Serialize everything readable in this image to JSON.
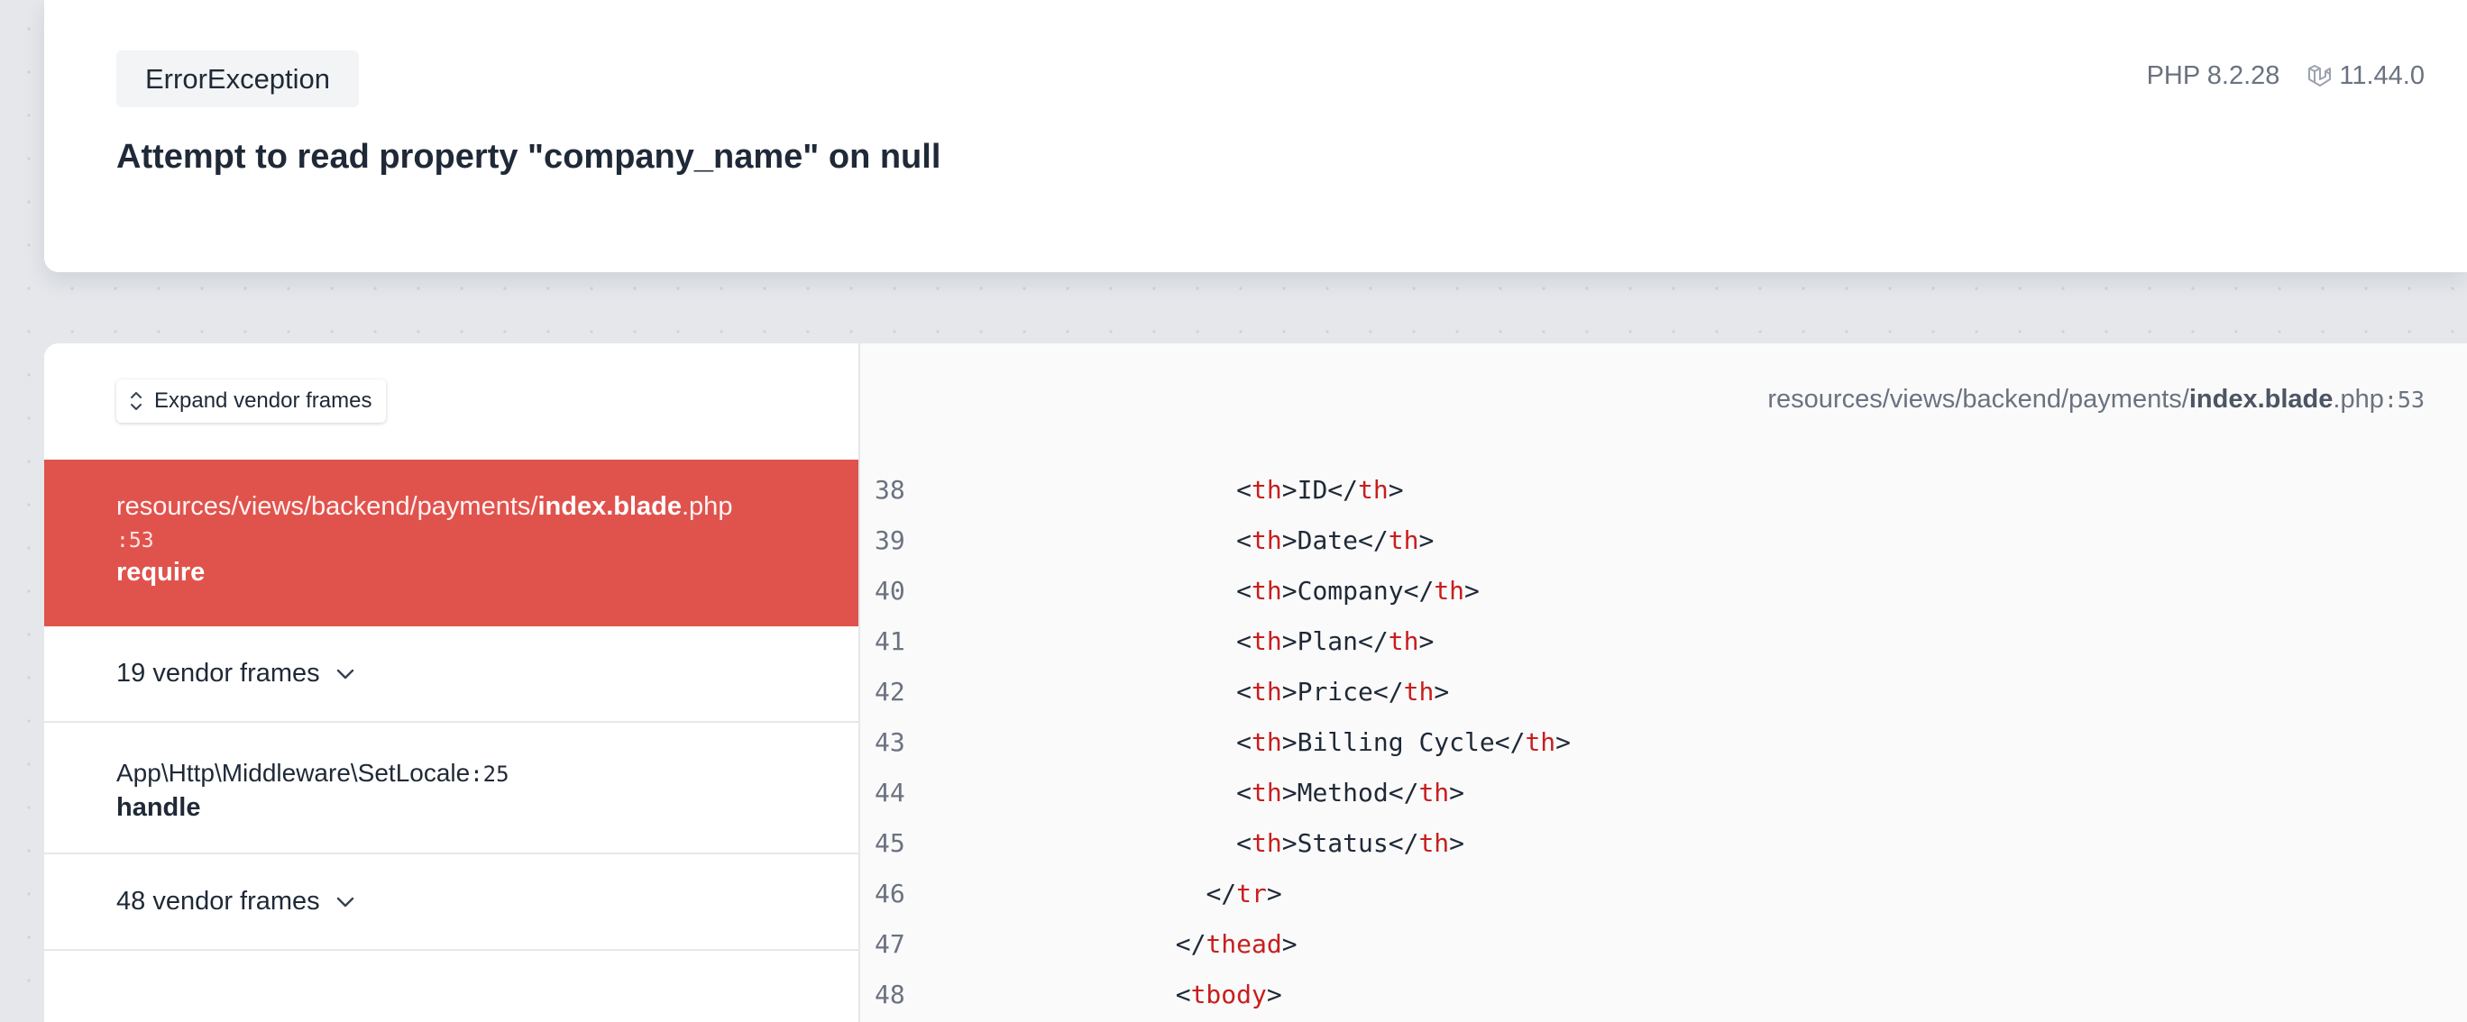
{
  "header": {
    "exception_type": "ErrorException",
    "message": "Attempt to read property \"company_name\" on null",
    "php_version": "PHP 8.2.28",
    "laravel_version": "11.44.0"
  },
  "frames_panel": {
    "expand_label": "Expand vendor frames",
    "active_frame": {
      "path": "resources/views/backend/payments/",
      "file_bold": "index.blade",
      "file_ext": ".php",
      "line": ":53",
      "method": "require"
    },
    "vendor_group_1": "19 vendor frames",
    "app_frame": {
      "class": "App\\Http\\Middleware\\SetLocale",
      "line": ":25",
      "method": "handle"
    },
    "vendor_group_2": "48 vendor frames"
  },
  "code_panel": {
    "file_path": "resources/views/backend/payments/",
    "file_bold": "index.blade",
    "file_ext": ".php",
    "line": ":53",
    "lines": [
      {
        "num": "38",
        "indent": "                    ",
        "open": "<",
        "tag": "th",
        "mid": ">ID</",
        "tag2": "th",
        "close": ">"
      },
      {
        "num": "39",
        "indent": "                    ",
        "open": "<",
        "tag": "th",
        "mid": ">Date</",
        "tag2": "th",
        "close": ">"
      },
      {
        "num": "40",
        "indent": "                    ",
        "open": "<",
        "tag": "th",
        "mid": ">Company</",
        "tag2": "th",
        "close": ">"
      },
      {
        "num": "41",
        "indent": "                    ",
        "open": "<",
        "tag": "th",
        "mid": ">Plan</",
        "tag2": "th",
        "close": ">"
      },
      {
        "num": "42",
        "indent": "                    ",
        "open": "<",
        "tag": "th",
        "mid": ">Price</",
        "tag2": "th",
        "close": ">"
      },
      {
        "num": "43",
        "indent": "                    ",
        "open": "<",
        "tag": "th",
        "mid": ">Billing Cycle</",
        "tag2": "th",
        "close": ">"
      },
      {
        "num": "44",
        "indent": "                    ",
        "open": "<",
        "tag": "th",
        "mid": ">Method</",
        "tag2": "th",
        "close": ">"
      },
      {
        "num": "45",
        "indent": "                    ",
        "open": "<",
        "tag": "th",
        "mid": ">Status</",
        "tag2": "th",
        "close": ">"
      },
      {
        "num": "46",
        "indent": "                  ",
        "open": "</",
        "tag": "tr",
        "mid": ">",
        "tag2": "",
        "close": ""
      },
      {
        "num": "47",
        "indent": "                ",
        "open": "</",
        "tag": "thead",
        "mid": ">",
        "tag2": "",
        "close": ""
      },
      {
        "num": "48",
        "indent": "                ",
        "open": "<",
        "tag": "tbody",
        "mid": ">",
        "tag2": "",
        "close": ""
      }
    ]
  },
  "colors": {
    "active_frame_bg": "#e0534d",
    "tag_color": "#c81e1e"
  }
}
